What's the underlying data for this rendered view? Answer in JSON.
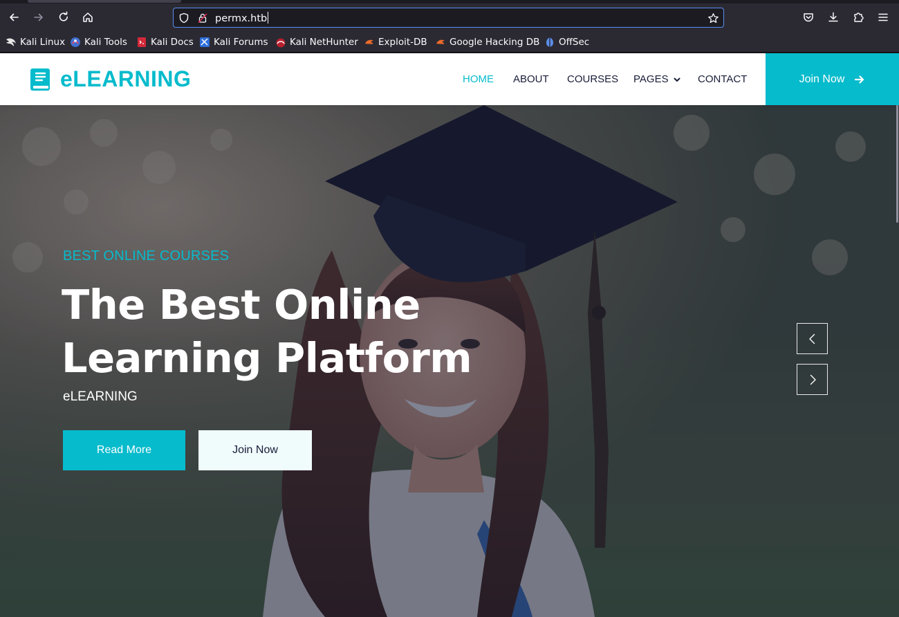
{
  "browser": {
    "url": "permx.htb",
    "bookmarks": [
      {
        "label": "Kali Linux",
        "icon": "kali-dragon-icon"
      },
      {
        "label": "Kali Tools",
        "icon": "kali-tools-icon"
      },
      {
        "label": "Kali Docs",
        "icon": "kali-docs-icon"
      },
      {
        "label": "Kali Forums",
        "icon": "kali-forums-icon"
      },
      {
        "label": "Kali NetHunter",
        "icon": "kali-nethunter-icon"
      },
      {
        "label": "Exploit-DB",
        "icon": "exploit-db-icon"
      },
      {
        "label": "Google Hacking DB",
        "icon": "ghdb-icon"
      },
      {
        "label": "OffSec",
        "icon": "offsec-icon"
      }
    ]
  },
  "site": {
    "brand": "eLEARNING",
    "nav": [
      {
        "label": "HOME",
        "active": true
      },
      {
        "label": "ABOUT"
      },
      {
        "label": "COURSES"
      },
      {
        "label": "PAGES",
        "dropdown": true
      },
      {
        "label": "CONTACT"
      }
    ],
    "join_cta": "Join Now",
    "accent": "#06bbcc",
    "dark": "#181d38"
  },
  "hero": {
    "kicker": "BEST ONLINE COURSES",
    "title_line1": "The Best Online",
    "title_line2": "Learning Platform",
    "subtitle": "eLEARNING",
    "primary_button": "Read More",
    "secondary_button": "Join Now"
  }
}
